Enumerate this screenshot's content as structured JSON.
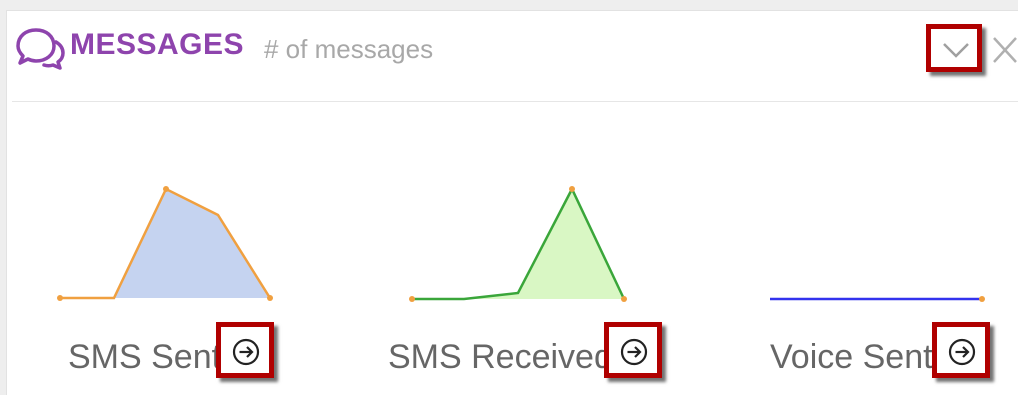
{
  "header": {
    "title": "MESSAGES",
    "subtitle": "# of messages",
    "icon": "chat-bubbles-icon",
    "accent_color": "#8e44ad"
  },
  "controls": {
    "collapse_icon": "chevron-down-icon",
    "close_icon": "close-icon"
  },
  "metrics": [
    {
      "label": "SMS Sent",
      "action_icon": "arrow-circle-right-icon",
      "line_color": "#f0a040",
      "fill_color": "#c5d3f0"
    },
    {
      "label": "SMS Received",
      "action_icon": "arrow-circle-right-icon",
      "line_color": "#3aa63a",
      "fill_color": "#d9f7c4"
    },
    {
      "label": "Voice Sent",
      "action_icon": "arrow-circle-right-icon",
      "line_color": "#3333ee",
      "fill_color": "none"
    }
  ]
}
